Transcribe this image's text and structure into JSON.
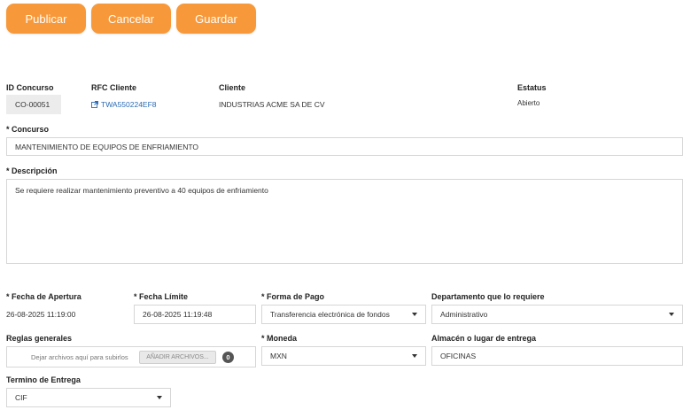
{
  "toolbar": {
    "publish_label": "Publicar",
    "cancel_label": "Cancelar",
    "save_label": "Guardar",
    "accent_color": "#f7993a"
  },
  "header": {
    "id_label": "ID Concurso",
    "id_value": "CO-00051",
    "rfc_label": "RFC Cliente",
    "rfc_value": "TWA550224EF8",
    "client_label": "Cliente",
    "client_value": "INDUSTRIAS ACME SA DE CV",
    "status_label": "Estatus",
    "status_value": "Abierto"
  },
  "form": {
    "concurso_label": "Concurso",
    "concurso_value": "MANTENIMIENTO DE EQUIPOS DE ENFRIAMIENTO",
    "descripcion_label": "Descripción",
    "descripcion_value": "Se requiere realizar mantenimiento preventivo a 40 equipos de enfriamiento",
    "fecha_apertura_label": "Fecha de Apertura",
    "fecha_apertura_value": "26-08-2025 11:19:00",
    "fecha_limite_label": "Fecha Límite",
    "fecha_limite_value": "26-08-2025 11:19:48",
    "forma_pago_label": "Forma de Pago",
    "forma_pago_value": "Transferencia electrónica de fondos",
    "departamento_label": "Departamento que lo requiere",
    "departamento_value": "Administrativo",
    "reglas_label": "Reglas generales",
    "upload_hint": "Dejar archivos aquí para subirlos",
    "upload_button": "AÑADIR ARCHIVOS...",
    "upload_count": "0",
    "moneda_label": "Moneda",
    "moneda_value": "MXN",
    "almacen_label": "Almacén o lugar de entrega",
    "almacen_value": "OFICINAS",
    "termino_label": "Termino de Entrega",
    "termino_value": "CIF",
    "required_mark": "*"
  }
}
